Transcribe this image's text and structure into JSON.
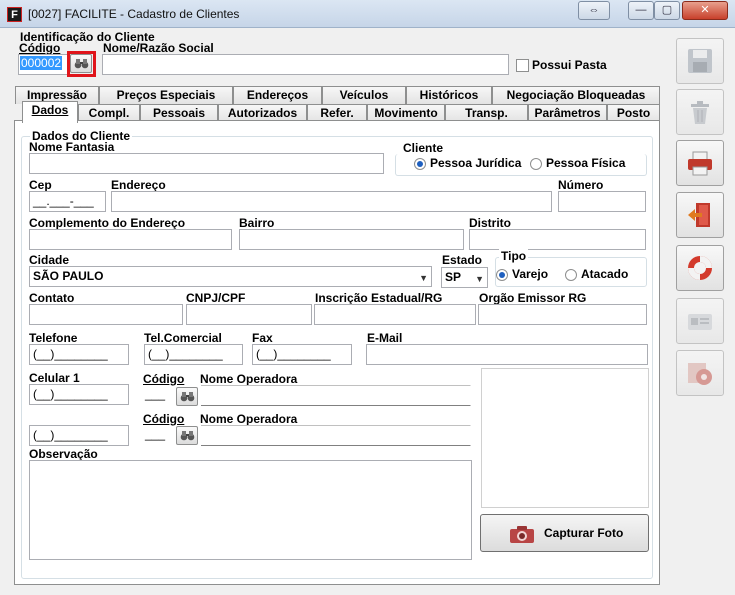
{
  "window": {
    "title": "[0027] FACILITE - Cadastro de Clientes",
    "app_icon_letter": "F",
    "restore_glyph": "⇔",
    "minimize_glyph": "—",
    "maximize_glyph": "▢",
    "close_glyph": "✕"
  },
  "header": {
    "section_label": "Identificação do Cliente",
    "code_label": "Código",
    "code_value": "000002",
    "name_label": "Nome/Razão Social",
    "name_value": "",
    "has_folder_label": "Possui Pasta"
  },
  "tabs": {
    "row1": [
      "Impressão",
      "Preços Especiais",
      "Endereços",
      "Veículos",
      "Históricos",
      "Negociação Bloqueadas"
    ],
    "row2": [
      "Dados",
      "Compl.",
      "Pessoais",
      "Autorizados",
      "Refer.",
      "Movimento",
      "Transp.",
      "Parâmetros",
      "Posto"
    ]
  },
  "form": {
    "group_title": "Dados do Cliente",
    "nome_fantasia_label": "Nome Fantasia",
    "client_type_label": "Cliente",
    "pessoa_juridica": "Pessoa Jurídica",
    "pessoa_fisica": "Pessoa Física",
    "cep_label": "Cep",
    "cep_mask": "__.___-___",
    "endereco_label": "Endereço",
    "numero_label": "Número",
    "complemento_label": "Complemento do Endereço",
    "bairro_label": "Bairro",
    "distrito_label": "Distrito",
    "cidade_label": "Cidade",
    "cidade_value": "SÃO PAULO",
    "estado_label": "Estado",
    "estado_value": "SP",
    "tipo_label": "Tipo",
    "varejo": "Varejo",
    "atacado": "Atacado",
    "contato_label": "Contato",
    "cnpj_label": "CNPJ/CPF",
    "ie_label": "Inscrição Estadual/RG",
    "orgao_label": "Orgão Emissor RG",
    "telefone_label": "Telefone",
    "tel_comercial_label": "Tel.Comercial",
    "fax_label": "Fax",
    "email_label": "E-Mail",
    "phone_mask": "(__)________",
    "celular_label": "Celular 1",
    "codigo_label": "Código",
    "nome_operadora_label": "Nome Operadora",
    "code_mask": "___",
    "observacao_label": "Observação",
    "capture_photo_label": "Capturar Foto"
  }
}
